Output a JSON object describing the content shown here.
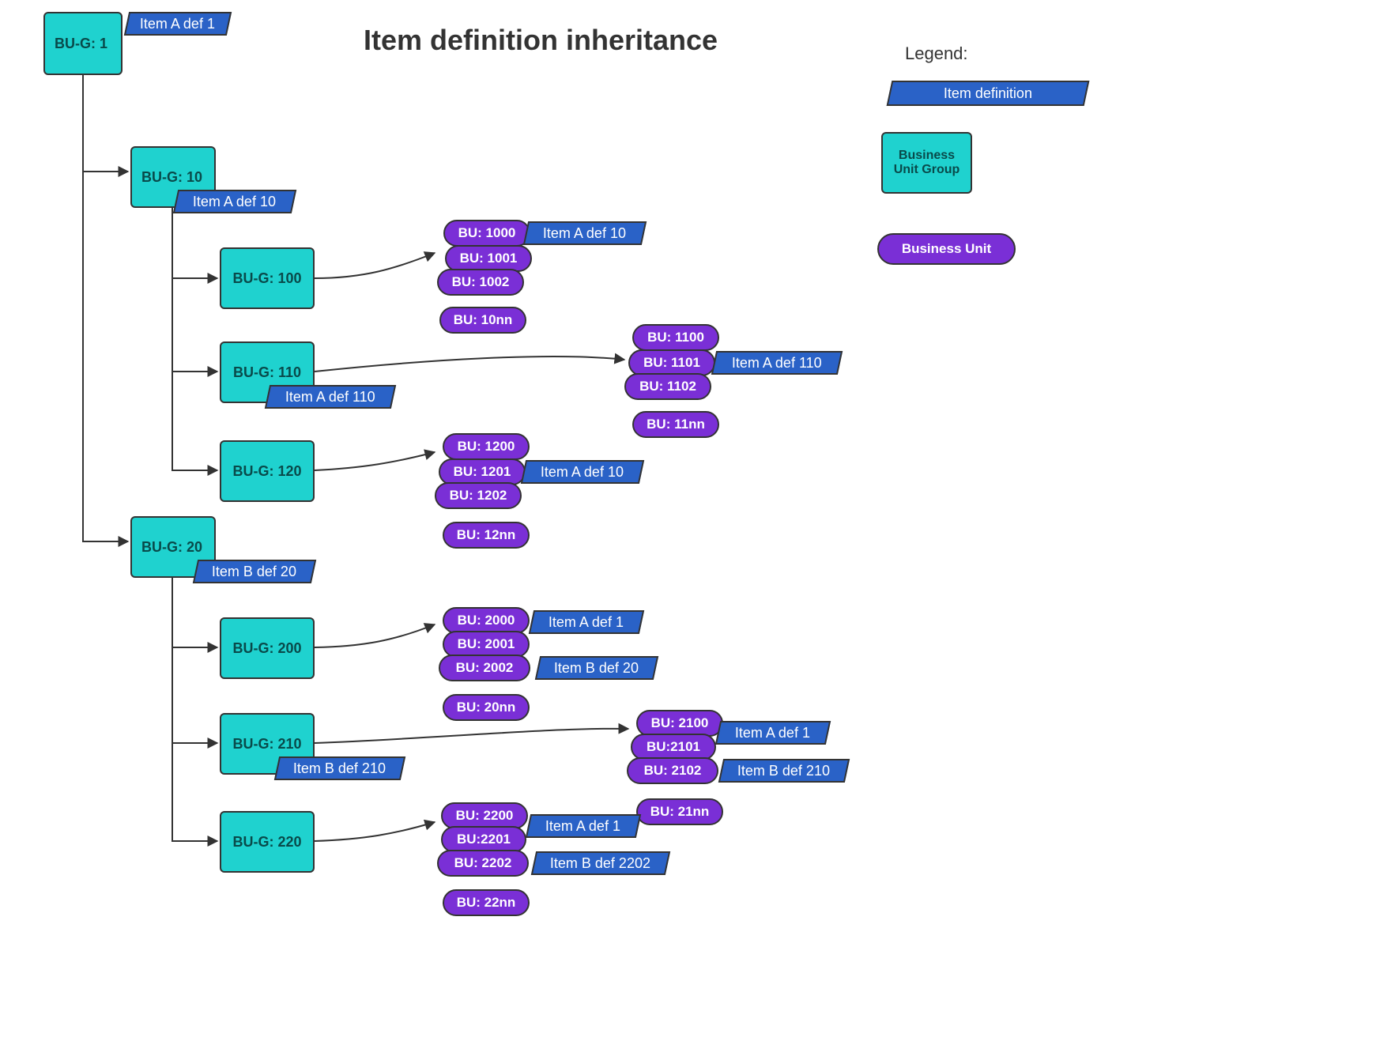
{
  "title": "Item definition inheritance",
  "legend": {
    "title": "Legend:",
    "itemdef": "Item definition",
    "bug": "Business\nUnit Group",
    "bu": "Business Unit"
  },
  "nodes": {
    "bug_1": "BU-G: 1",
    "bug_10": "BU-G: 10",
    "bug_100": "BU-G: 100",
    "bug_110": "BU-G: 110",
    "bug_120": "BU-G: 120",
    "bug_20": "BU-G: 20",
    "bug_200": "BU-G: 200",
    "bug_210": "BU-G: 210",
    "bug_220": "BU-G: 220"
  },
  "itemdefs": {
    "a1_root": "Item A def 1",
    "a10_at10": "Item A def 10",
    "a10_at1000": "Item A def 10",
    "a110_at110": "Item A def 110",
    "a110_at1101": "Item A def 110",
    "a10_at1201": "Item A def 10",
    "b20_at20": "Item B def 20",
    "a1_at2001": "Item A def 1",
    "b20_at2002": "Item B def 20",
    "b210_at210": "Item B def 210",
    "a1_at2101": "Item A def 1",
    "b210_at2102": "Item B def 210",
    "a1_at2201": "Item A def 1",
    "b2202_at2202": "Item B def 2202"
  },
  "bu": {
    "b1000": "BU: 1000",
    "b1001": "BU: 1001",
    "b1002": "BU: 1002",
    "b10nn": "BU: 10nn",
    "b1100": "BU: 1100",
    "b1101": "BU: 1101",
    "b1102": "BU: 1102",
    "b11nn": "BU: 11nn",
    "b1200": "BU: 1200",
    "b1201": "BU: 1201",
    "b1202": "BU: 1202",
    "b12nn": "BU: 12nn",
    "b2000": "BU: 2000",
    "b2001": "BU: 2001",
    "b2002": "BU: 2002",
    "b20nn": "BU: 20nn",
    "b2100": "BU: 2100",
    "b2101": "BU:2101",
    "b2102": "BU: 2102",
    "b21nn": "BU: 21nn",
    "b2200": "BU: 2200",
    "b2201": "BU:2201",
    "b2202": "BU: 2202",
    "b22nn": "BU: 22nn"
  },
  "chart_data": {
    "type": "tree",
    "title": "Item definition inheritance",
    "legend": {
      "item_definition": "blue parallelogram",
      "business_unit_group": "teal rectangle",
      "business_unit": "purple rounded pill"
    },
    "item_definitions_declared": {
      "BU-G: 1": [
        "Item A def 1"
      ],
      "BU-G: 10": [
        "Item A def 10"
      ],
      "BU-G: 110": [
        "Item A def 110"
      ],
      "BU-G: 20": [
        "Item B def 20"
      ],
      "BU-G: 210": [
        "Item B def 210"
      ],
      "BU: 2202": [
        "Item B def 2202"
      ]
    },
    "hierarchy": {
      "id": "BU-G: 1",
      "type": "group",
      "children": [
        {
          "id": "BU-G: 10",
          "type": "group",
          "children": [
            {
              "id": "BU-G: 100",
              "type": "group",
              "children": [
                {
                  "id": "BU: 1000",
                  "type": "unit",
                  "inherits": [
                    "Item A def 10"
                  ]
                },
                {
                  "id": "BU: 1001",
                  "type": "unit"
                },
                {
                  "id": "BU: 1002",
                  "type": "unit"
                },
                {
                  "id": "BU: 10nn",
                  "type": "unit"
                }
              ]
            },
            {
              "id": "BU-G: 110",
              "type": "group",
              "children": [
                {
                  "id": "BU: 1100",
                  "type": "unit"
                },
                {
                  "id": "BU: 1101",
                  "type": "unit",
                  "inherits": [
                    "Item A def 110"
                  ]
                },
                {
                  "id": "BU: 1102",
                  "type": "unit"
                },
                {
                  "id": "BU: 11nn",
                  "type": "unit"
                }
              ]
            },
            {
              "id": "BU-G: 120",
              "type": "group",
              "children": [
                {
                  "id": "BU: 1200",
                  "type": "unit"
                },
                {
                  "id": "BU: 1201",
                  "type": "unit",
                  "inherits": [
                    "Item A def 10"
                  ]
                },
                {
                  "id": "BU: 1202",
                  "type": "unit"
                },
                {
                  "id": "BU: 12nn",
                  "type": "unit"
                }
              ]
            }
          ]
        },
        {
          "id": "BU-G: 20",
          "type": "group",
          "children": [
            {
              "id": "BU-G: 200",
              "type": "group",
              "children": [
                {
                  "id": "BU: 2000",
                  "type": "unit"
                },
                {
                  "id": "BU: 2001",
                  "type": "unit",
                  "inherits": [
                    "Item A def 1"
                  ]
                },
                {
                  "id": "BU: 2002",
                  "type": "unit",
                  "inherits": [
                    "Item B def 20"
                  ]
                },
                {
                  "id": "BU: 20nn",
                  "type": "unit"
                }
              ]
            },
            {
              "id": "BU-G: 210",
              "type": "group",
              "children": [
                {
                  "id": "BU: 2100",
                  "type": "unit"
                },
                {
                  "id": "BU: 2101",
                  "type": "unit",
                  "inherits": [
                    "Item A def 1"
                  ]
                },
                {
                  "id": "BU: 2102",
                  "type": "unit",
                  "inherits": [
                    "Item B def 210"
                  ]
                },
                {
                  "id": "BU: 21nn",
                  "type": "unit"
                }
              ]
            },
            {
              "id": "BU-G: 220",
              "type": "group",
              "children": [
                {
                  "id": "BU: 2200",
                  "type": "unit"
                },
                {
                  "id": "BU: 2201",
                  "type": "unit",
                  "inherits": [
                    "Item A def 1"
                  ]
                },
                {
                  "id": "BU: 2202",
                  "type": "unit",
                  "inherits": [
                    "Item B def 2202"
                  ]
                },
                {
                  "id": "BU: 22nn",
                  "type": "unit"
                }
              ]
            }
          ]
        }
      ]
    }
  }
}
